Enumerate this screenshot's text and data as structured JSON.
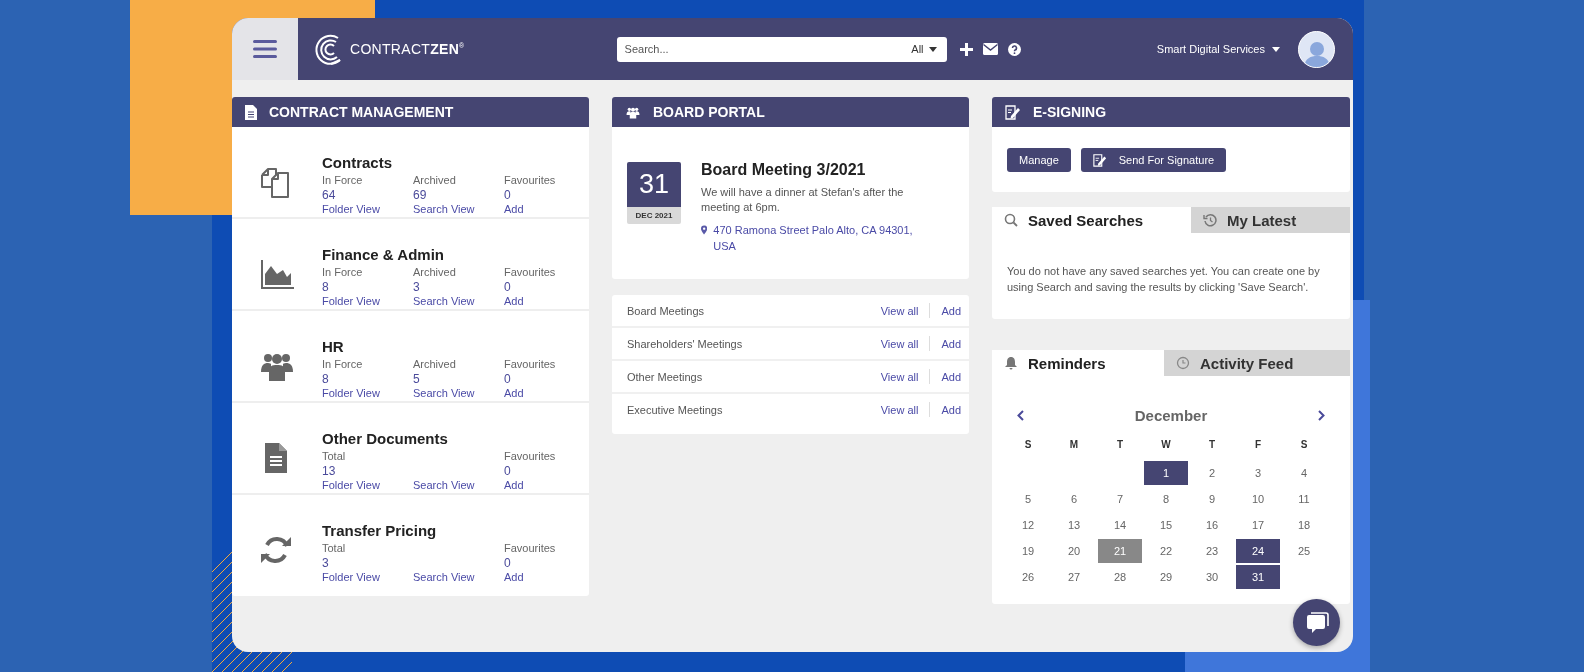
{
  "header": {
    "logo": "CONTRACT**ZEN**$^{®}$",
    "search": {
      "placeholder": "Search...",
      "scope": "All"
    },
    "account": "Smart Digital Services"
  },
  "contract_management": {
    "title": "CONTRACT MANAGEMENT",
    "categories": [
      {
        "kind": "contracts",
        "title": "Contracts",
        "stats": [
          {
            "label": "In Force",
            "value": "64",
            "link": "Folder View"
          },
          {
            "label": "Archived",
            "value": "69",
            "link": "Search View"
          },
          {
            "label": "Favourites",
            "value": "0",
            "link": "Add"
          }
        ]
      },
      {
        "kind": "finance",
        "title": "Finance & Admin",
        "stats": [
          {
            "label": "In Force",
            "value": "8",
            "link": "Folder View"
          },
          {
            "label": "Archived",
            "value": "3",
            "link": "Search View"
          },
          {
            "label": "Favourites",
            "value": "0",
            "link": "Add"
          }
        ]
      },
      {
        "kind": "hr",
        "title": "HR",
        "stats": [
          {
            "label": "In Force",
            "value": "8",
            "link": "Folder View"
          },
          {
            "label": "Archived",
            "value": "5",
            "link": "Search View"
          },
          {
            "label": "Favourites",
            "value": "0",
            "link": "Add"
          }
        ]
      },
      {
        "kind": "documents",
        "title": "Other Documents",
        "stats": [
          {
            "label": "Total",
            "value": "13",
            "link": "Folder View"
          },
          {
            "link": "Search View"
          },
          {
            "label": "Favourites",
            "value": "0",
            "link": "Add"
          }
        ]
      },
      {
        "kind": "transfer",
        "title": "Transfer Pricing",
        "stats": [
          {
            "label": "Total",
            "value": "3",
            "link": "Folder View"
          },
          {
            "link": "Search View"
          },
          {
            "label": "Favourites",
            "value": "0",
            "link": "Add"
          }
        ]
      }
    ]
  },
  "board_portal": {
    "title": "BOARD PORTAL",
    "meeting": {
      "day": "31",
      "month_year": "DEC 2021",
      "title": "Board Meeting 3/2021",
      "description": "We will have a dinner at Stefan's after the meeting at 6pm.",
      "address": "470 Ramona Street Palo Alto, CA 94301, USA"
    },
    "meeting_types": [
      {
        "name": "Board Meetings",
        "view_link": "View all",
        "add_link": "Add"
      },
      {
        "name": "Shareholders' Meetings",
        "view_link": "View all",
        "add_link": "Add"
      },
      {
        "name": "Other Meetings",
        "view_link": "View all",
        "add_link": "Add"
      },
      {
        "name": "Executive Meetings",
        "view_link": "View all",
        "add_link": "Add"
      }
    ]
  },
  "e_signing": {
    "title": "E-SIGNING",
    "buttons": [
      {
        "label": "Manage",
        "kind": "plain"
      },
      {
        "label": "Send For Signature",
        "kind": "sign"
      }
    ]
  },
  "searches_panel": {
    "tabs": [
      {
        "label": "Saved Searches",
        "kind": "search",
        "selected": true
      },
      {
        "label": "My Latest",
        "kind": "history",
        "selected": false
      }
    ],
    "message": "You do not have any saved searches yet. You can create one by using Search and saving the results by clicking 'Save Search'."
  },
  "reminders_panel": {
    "tabs": [
      {
        "label": "Reminders",
        "kind": "bell",
        "selected": true
      },
      {
        "label": "Activity Feed",
        "kind": "clock",
        "selected": false
      }
    ],
    "calendar": {
      "month": "December",
      "weekdays": [
        "S",
        "M",
        "T",
        "W",
        "T",
        "F",
        "S"
      ],
      "weeks": [
        [
          {
            "kind": "blank"
          },
          {
            "kind": "blank"
          },
          {
            "kind": "blank"
          },
          {
            "day": "1",
            "kind": "event"
          },
          {
            "day": "2",
            "kind": "plain"
          },
          {
            "day": "3",
            "kind": "plain"
          },
          {
            "day": "4",
            "kind": "plain"
          }
        ],
        [
          {
            "day": "5",
            "kind": "plain"
          },
          {
            "day": "6",
            "kind": "plain"
          },
          {
            "day": "7",
            "kind": "plain"
          },
          {
            "day": "8",
            "kind": "plain"
          },
          {
            "day": "9",
            "kind": "plain"
          },
          {
            "day": "10",
            "kind": "plain"
          },
          {
            "day": "11",
            "kind": "plain"
          }
        ],
        [
          {
            "day": "12",
            "kind": "plain"
          },
          {
            "day": "13",
            "kind": "plain"
          },
          {
            "day": "14",
            "kind": "plain"
          },
          {
            "day": "15",
            "kind": "plain"
          },
          {
            "day": "16",
            "kind": "plain"
          },
          {
            "day": "17",
            "kind": "plain"
          },
          {
            "day": "18",
            "kind": "plain"
          }
        ],
        [
          {
            "day": "19",
            "kind": "plain"
          },
          {
            "day": "20",
            "kind": "plain"
          },
          {
            "day": "21",
            "kind": "today"
          },
          {
            "day": "22",
            "kind": "plain"
          },
          {
            "day": "23",
            "kind": "plain"
          },
          {
            "day": "24",
            "kind": "event"
          },
          {
            "day": "25",
            "kind": "plain"
          }
        ],
        [
          {
            "day": "26",
            "kind": "plain"
          },
          {
            "day": "27",
            "kind": "plain"
          },
          {
            "day": "28",
            "kind": "plain"
          },
          {
            "day": "29",
            "kind": "plain"
          },
          {
            "day": "30",
            "kind": "plain"
          },
          {
            "day": "31",
            "kind": "event"
          },
          {
            "kind": "blank"
          }
        ]
      ]
    }
  }
}
